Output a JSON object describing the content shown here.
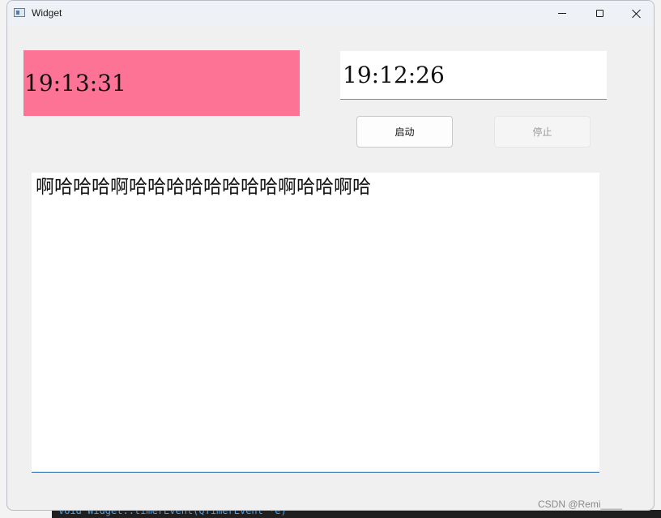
{
  "window": {
    "title": "Widget",
    "icon": "app-window-icon"
  },
  "titlebar_buttons": {
    "minimize_icon": "minimize-icon",
    "maximize_icon": "maximize-icon",
    "close_icon": "close-icon"
  },
  "clock_label": {
    "text": "19:13:31",
    "background": "#fd7396"
  },
  "time_edit": {
    "value": "19:12:26"
  },
  "buttons": {
    "start_label": "启动",
    "stop_label": "停止",
    "stop_enabled": false
  },
  "text_edit": {
    "value": "啊哈哈哈啊哈哈哈哈哈哈哈哈啊哈哈啊哈"
  },
  "watermark": "CSDN @Remi____",
  "background_code": "void Widget::timerEvent(QTimerEvent *e)"
}
